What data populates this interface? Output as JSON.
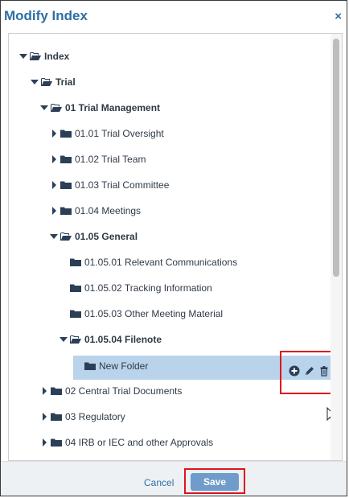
{
  "dialog": {
    "title": "Modify Index",
    "close_glyph": "×"
  },
  "tree": {
    "items": [
      {
        "label": "Index",
        "level": 0,
        "expanded": true,
        "bold": true,
        "has_caret": true,
        "open": true
      },
      {
        "label": "Trial",
        "level": 1,
        "expanded": true,
        "bold": true,
        "has_caret": true,
        "open": true
      },
      {
        "label": "01 Trial Management",
        "level": 2,
        "expanded": true,
        "bold": true,
        "has_caret": true,
        "open": true
      },
      {
        "label": "01.01 Trial Oversight",
        "level": 3,
        "expanded": false,
        "bold": false,
        "has_caret": true,
        "open": false
      },
      {
        "label": "01.02 Trial Team",
        "level": 3,
        "expanded": false,
        "bold": false,
        "has_caret": true,
        "open": false
      },
      {
        "label": "01.03 Trial Committee",
        "level": 3,
        "expanded": false,
        "bold": false,
        "has_caret": true,
        "open": false
      },
      {
        "label": "01.04 Meetings",
        "level": 3,
        "expanded": false,
        "bold": false,
        "has_caret": true,
        "open": false
      },
      {
        "label": "01.05 General",
        "level": 3,
        "expanded": true,
        "bold": true,
        "has_caret": true,
        "open": true
      },
      {
        "label": "01.05.01 Relevant Communications",
        "level": 4,
        "expanded": false,
        "bold": false,
        "has_caret": false,
        "open": false
      },
      {
        "label": "01.05.02 Tracking Information",
        "level": 4,
        "expanded": false,
        "bold": false,
        "has_caret": false,
        "open": false
      },
      {
        "label": "01.05.03 Other Meeting Material",
        "level": 4,
        "expanded": false,
        "bold": false,
        "has_caret": false,
        "open": false
      },
      {
        "label": "01.05.04 Filenote",
        "level": 4,
        "expanded": true,
        "bold": true,
        "has_caret": true,
        "open": true
      },
      {
        "label": "New Folder",
        "level": 5,
        "expanded": false,
        "bold": false,
        "has_caret": false,
        "open": false,
        "selected": true
      },
      {
        "label": "02 Central Trial Documents",
        "level": 2,
        "expanded": false,
        "bold": false,
        "has_caret": true,
        "open": false
      },
      {
        "label": "03 Regulatory",
        "level": 2,
        "expanded": false,
        "bold": false,
        "has_caret": true,
        "open": false
      },
      {
        "label": "04 IRB or IEC and other Approvals",
        "level": 2,
        "expanded": false,
        "bold": false,
        "has_caret": true,
        "open": false
      }
    ]
  },
  "actions": {
    "icons": [
      "plus-circle-icon",
      "pencil-icon",
      "trash-icon"
    ]
  },
  "footer": {
    "cancel_label": "Cancel",
    "save_label": "Save"
  },
  "colors": {
    "accent": "#2e6ea5",
    "folder": "#2b3f57",
    "selection": "#b9d3ea",
    "highlight_border": "#e0141b",
    "save_button": "#6f9ccb"
  }
}
